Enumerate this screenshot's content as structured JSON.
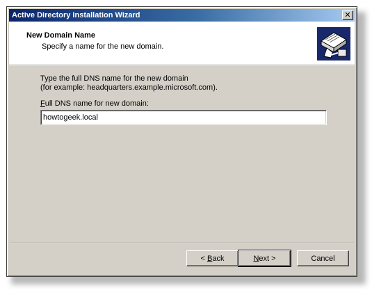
{
  "window": {
    "title": "Active Directory Installation Wizard",
    "close_glyph": "✕"
  },
  "header": {
    "title": "New Domain Name",
    "subtitle": "Specify a name for the new domain.",
    "icon": "wizard-book-network-icon"
  },
  "content": {
    "instruction_line1": "Type the full DNS name for the new domain",
    "instruction_line2": "(for example: headquarters.example.microsoft.com).",
    "field_label_accel": "F",
    "field_label_rest": "ull DNS name for new domain:",
    "field_value": "howtogeek.local"
  },
  "buttons": {
    "back_prefix": "< ",
    "back_accel": "B",
    "back_rest": "ack",
    "next_accel": "N",
    "next_rest": "ext >",
    "cancel": "Cancel"
  },
  "colors": {
    "dialog_face": "#d4d0c8",
    "titlebar_start": "#0a246a",
    "titlebar_end": "#a6caf0",
    "header_bg": "#ffffff"
  }
}
